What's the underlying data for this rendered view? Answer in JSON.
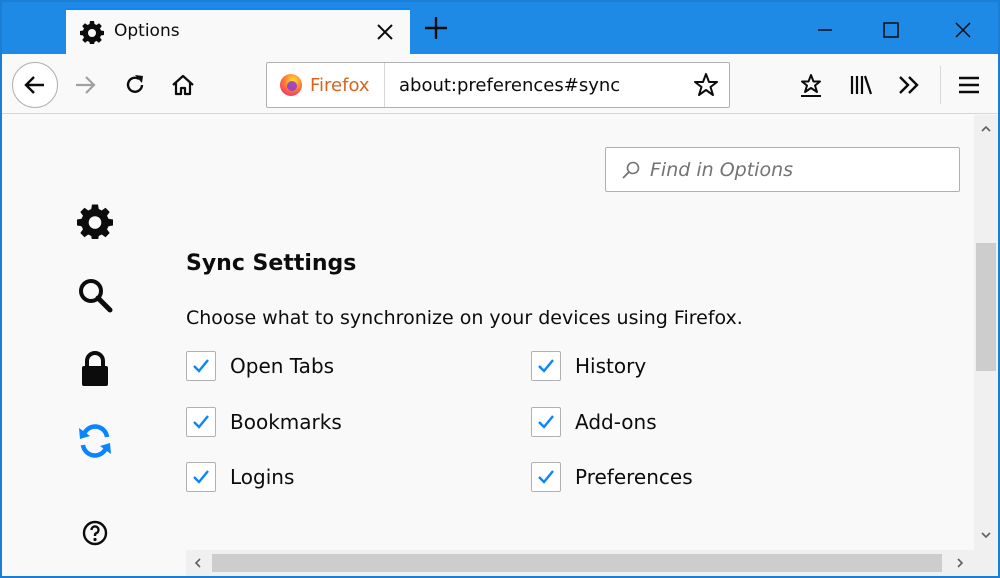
{
  "tab": {
    "title": "Options"
  },
  "urlbar": {
    "identity_label": "Firefox",
    "url": "about:preferences#sync"
  },
  "search": {
    "placeholder": "Find in Options"
  },
  "sync": {
    "heading": "Sync Settings",
    "description": "Choose what to synchronize on your devices using Firefox.",
    "options": [
      {
        "label": "Open Tabs",
        "checked": true
      },
      {
        "label": "Bookmarks",
        "checked": true
      },
      {
        "label": "Logins",
        "checked": true
      },
      {
        "label": "History",
        "checked": true
      },
      {
        "label": "Add-ons",
        "checked": true
      },
      {
        "label": "Preferences",
        "checked": true
      }
    ]
  },
  "categories": [
    {
      "icon": "gear-icon"
    },
    {
      "icon": "search-icon"
    },
    {
      "icon": "lock-icon"
    },
    {
      "icon": "sync-icon",
      "selected": true
    },
    {
      "icon": "help-icon"
    }
  ],
  "colors": {
    "titlebar": "#1e8ae6",
    "accent": "#0a84ff",
    "check": "#0a84ff",
    "identity": "#d7641e"
  }
}
